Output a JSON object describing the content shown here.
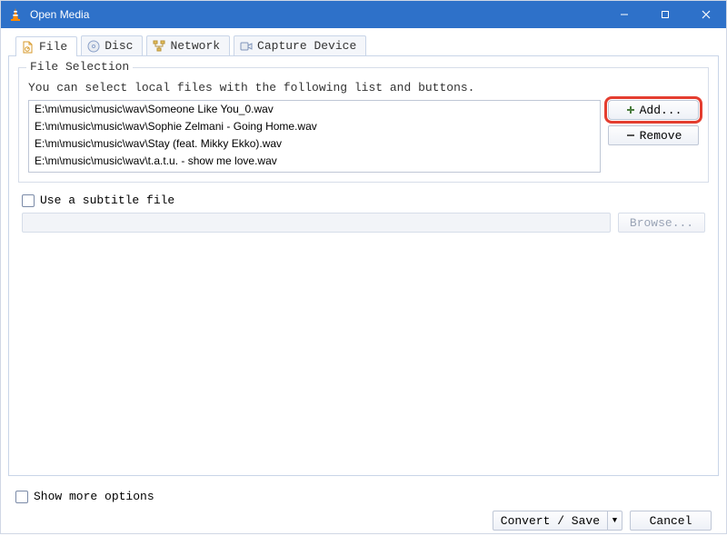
{
  "window": {
    "title": "Open Media"
  },
  "tabs": {
    "file": {
      "label": "File"
    },
    "disc": {
      "label": "Disc"
    },
    "network": {
      "label": "Network"
    },
    "capture": {
      "label": "Capture Device"
    }
  },
  "fileSelection": {
    "legend": "File Selection",
    "hint": "You can select local files with the following list and buttons.",
    "files": [
      "E:\\mι\\music\\music\\wav\\Someone Like You_0.wav",
      "E:\\mι\\music\\music\\wav\\Sophie Zelmani - Going Home.wav",
      "E:\\mι\\music\\music\\wav\\Stay (feat. Mikky Ekko).wav",
      "E:\\mι\\music\\music\\wav\\t.a.t.u. - show me love.wav"
    ],
    "addLabel": "Add...",
    "removeLabel": "Remove"
  },
  "subtitle": {
    "checkboxLabel": "Use a subtitle file",
    "browseLabel": "Browse..."
  },
  "footer": {
    "moreOptionsLabel": "Show more options",
    "convertLabel": "Convert / Save",
    "cancelLabel": "Cancel"
  }
}
